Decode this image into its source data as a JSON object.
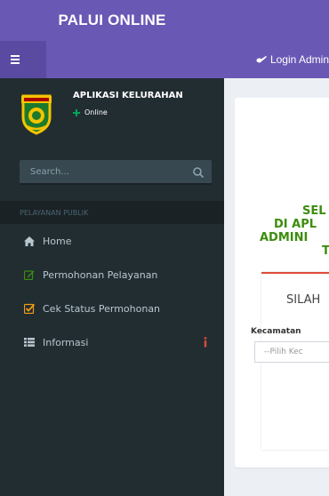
{
  "header": {
    "brand": "PALUI ONLINE",
    "login_label": "Login Admin"
  },
  "sidebar": {
    "user": {
      "name": "APLIKASI KELURAHAN",
      "status": "Online"
    },
    "search": {
      "placeholder": "Search..."
    },
    "section_title": "PELAYANAN PUBLIK",
    "menu": [
      {
        "label": "Home",
        "icon": "home-icon"
      },
      {
        "label": "Permohonan Pelayanan",
        "icon": "edit-icon"
      },
      {
        "label": "Cek Status Permohonan",
        "icon": "check-square-icon"
      },
      {
        "label": "Informasi",
        "icon": "grid-icon"
      }
    ]
  },
  "main": {
    "welcome_lines": [
      "SEL",
      "DI APL",
      "ADMINI",
      "T"
    ],
    "login_prompt": "SILAH",
    "kecamatan_label": "Kecamatan",
    "kecamatan_select": "--Pilih Kec"
  },
  "colors": {
    "header": "#6a58b5",
    "sidebar": "#222d32",
    "accent_green": "#3c8d0d",
    "accent_red": "#dd4b39",
    "status_online": "#00a65a"
  }
}
